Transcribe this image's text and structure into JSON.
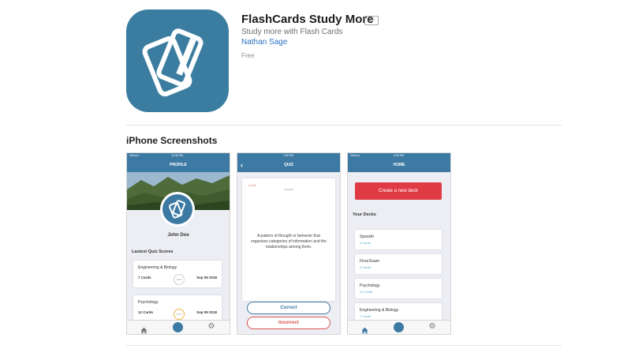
{
  "app": {
    "title": "FlashCards Study More",
    "age_rating": "4+",
    "subtitle": "Study more with Flash Cards",
    "developer": "Nathan Sage",
    "price": "Free"
  },
  "section_title": "iPhone Screenshots",
  "profile_screen": {
    "carrier": "Verizon",
    "time": "10:36 PM",
    "nav_title": "PROFILE",
    "user_name": "John Doe",
    "scores_heading": "Lastest Quiz Scores",
    "scores": [
      {
        "name": "Engineering & Biology",
        "cards": "7 Cards",
        "date": "Sep 09 2018",
        "gauge": "100%"
      },
      {
        "name": "Psychology",
        "cards": "12 Cards",
        "date": "Sep 09 2018",
        "gauge": "50%"
      }
    ]
  },
  "quiz_screen": {
    "time": "7:50 PM",
    "nav_title": "QUIZ",
    "counter": "1 Left",
    "hint": "Answer",
    "definition": "A pattern of thought or behavior that organizes categories of information and the relationships among them.",
    "correct_label": "Correct",
    "incorrect_label": "Incorrect"
  },
  "home_screen": {
    "carrier": "Verizon",
    "time": "9:09 PM",
    "nav_title": "HOME",
    "create_label": "Create a new deck",
    "decks_heading": "Your Decks",
    "decks": [
      {
        "name": "Spanish",
        "count": "6 Cards"
      },
      {
        "name": "Final Exam",
        "count": "6 Cards"
      },
      {
        "name": "Psychology",
        "count": "12 Cards"
      },
      {
        "name": "Engineering & Biology",
        "count": "7 Cards"
      }
    ]
  },
  "colors": {
    "icon_bg": "#3b7da0",
    "nav_bg": "#3d7aa3",
    "create_button": "#e03a45",
    "incorrect": "#d9534f",
    "link": "#2a6fc0"
  },
  "icons": {
    "app_icon": "flashcards-icon",
    "tab_home": "home-icon",
    "tab_center": "flashcards-icon",
    "tab_settings": "gear-icon"
  }
}
